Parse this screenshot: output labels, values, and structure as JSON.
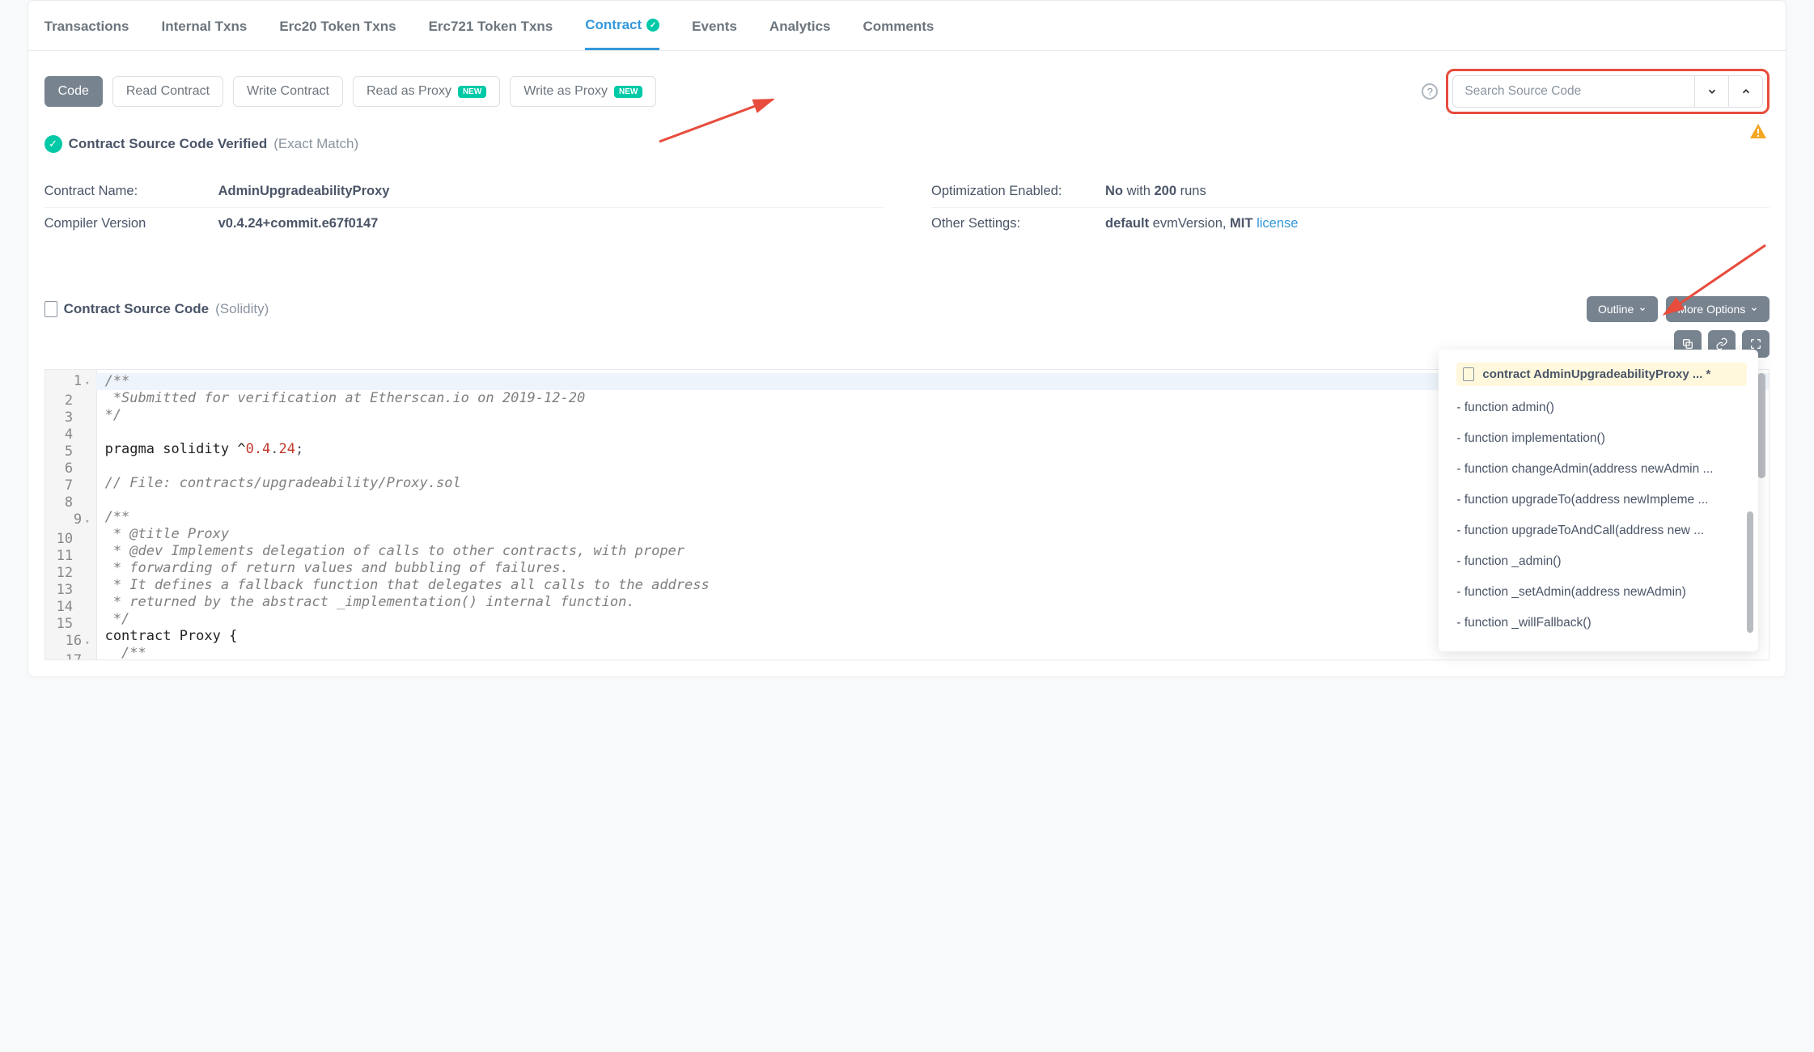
{
  "tabs": [
    "Transactions",
    "Internal Txns",
    "Erc20 Token Txns",
    "Erc721 Token Txns",
    "Contract",
    "Events",
    "Analytics",
    "Comments"
  ],
  "activeTab": "Contract",
  "subtabs": {
    "code": "Code",
    "read": "Read Contract",
    "write": "Write Contract",
    "readProxy": "Read as Proxy",
    "writeProxy": "Write as Proxy",
    "newBadge": "NEW"
  },
  "search": {
    "placeholder": "Search Source Code"
  },
  "verified": {
    "title": "Contract Source Code Verified",
    "suffix": "(Exact Match)"
  },
  "details": {
    "contractNameLabel": "Contract Name:",
    "contractNameValue": "AdminUpgradeabilityProxy",
    "compilerLabel": "Compiler Version",
    "compilerValue": "v0.4.24+commit.e67f0147",
    "optLabel": "Optimization Enabled:",
    "optBold1": "No",
    "optMid": " with ",
    "optBold2": "200",
    "optTail": " runs",
    "settingsLabel": "Other Settings:",
    "settingsBold1": "default",
    "settingsMid": " evmVersion, ",
    "settingsBold2": "MIT",
    "settingsLink": "license"
  },
  "sourceHeader": {
    "title": "Contract Source Code",
    "lang": "(Solidity)",
    "outlineBtn": "Outline",
    "moreBtn": "More Options"
  },
  "code": {
    "l1": "/**",
    "l2": " *Submitted for verification at Etherscan.io on 2019-12-20",
    "l3": "*/",
    "l4": "",
    "l5a": "pragma solidity ^",
    "l5b": "0.4",
    "l5c": ".",
    "l5d": "24",
    "l5e": ";",
    "l6": "",
    "l7": "// File: contracts/upgradeability/Proxy.sol",
    "l8": "",
    "l9": "/**",
    "l10": " * @title Proxy",
    "l11": " * @dev Implements delegation of calls to other contracts, with proper",
    "l12": " * forwarding of return values and bubbling of failures.",
    "l13": " * It defines a fallback function that delegates all calls to the address",
    "l14": " * returned by the abstract _implementation() internal function.",
    "l15": " */",
    "l16": "contract Proxy {",
    "l17": "  /**"
  },
  "outline": {
    "head": "contract AdminUpgradeabilityProxy ... *",
    "items": [
      "- function admin()",
      "- function implementation()",
      "- function changeAdmin(address newAdmin ...",
      "- function upgradeTo(address newImpleme ...",
      "- function upgradeToAndCall(address new ...",
      "- function _admin()",
      "- function _setAdmin(address newAdmin)",
      "- function _willFallback()"
    ]
  }
}
